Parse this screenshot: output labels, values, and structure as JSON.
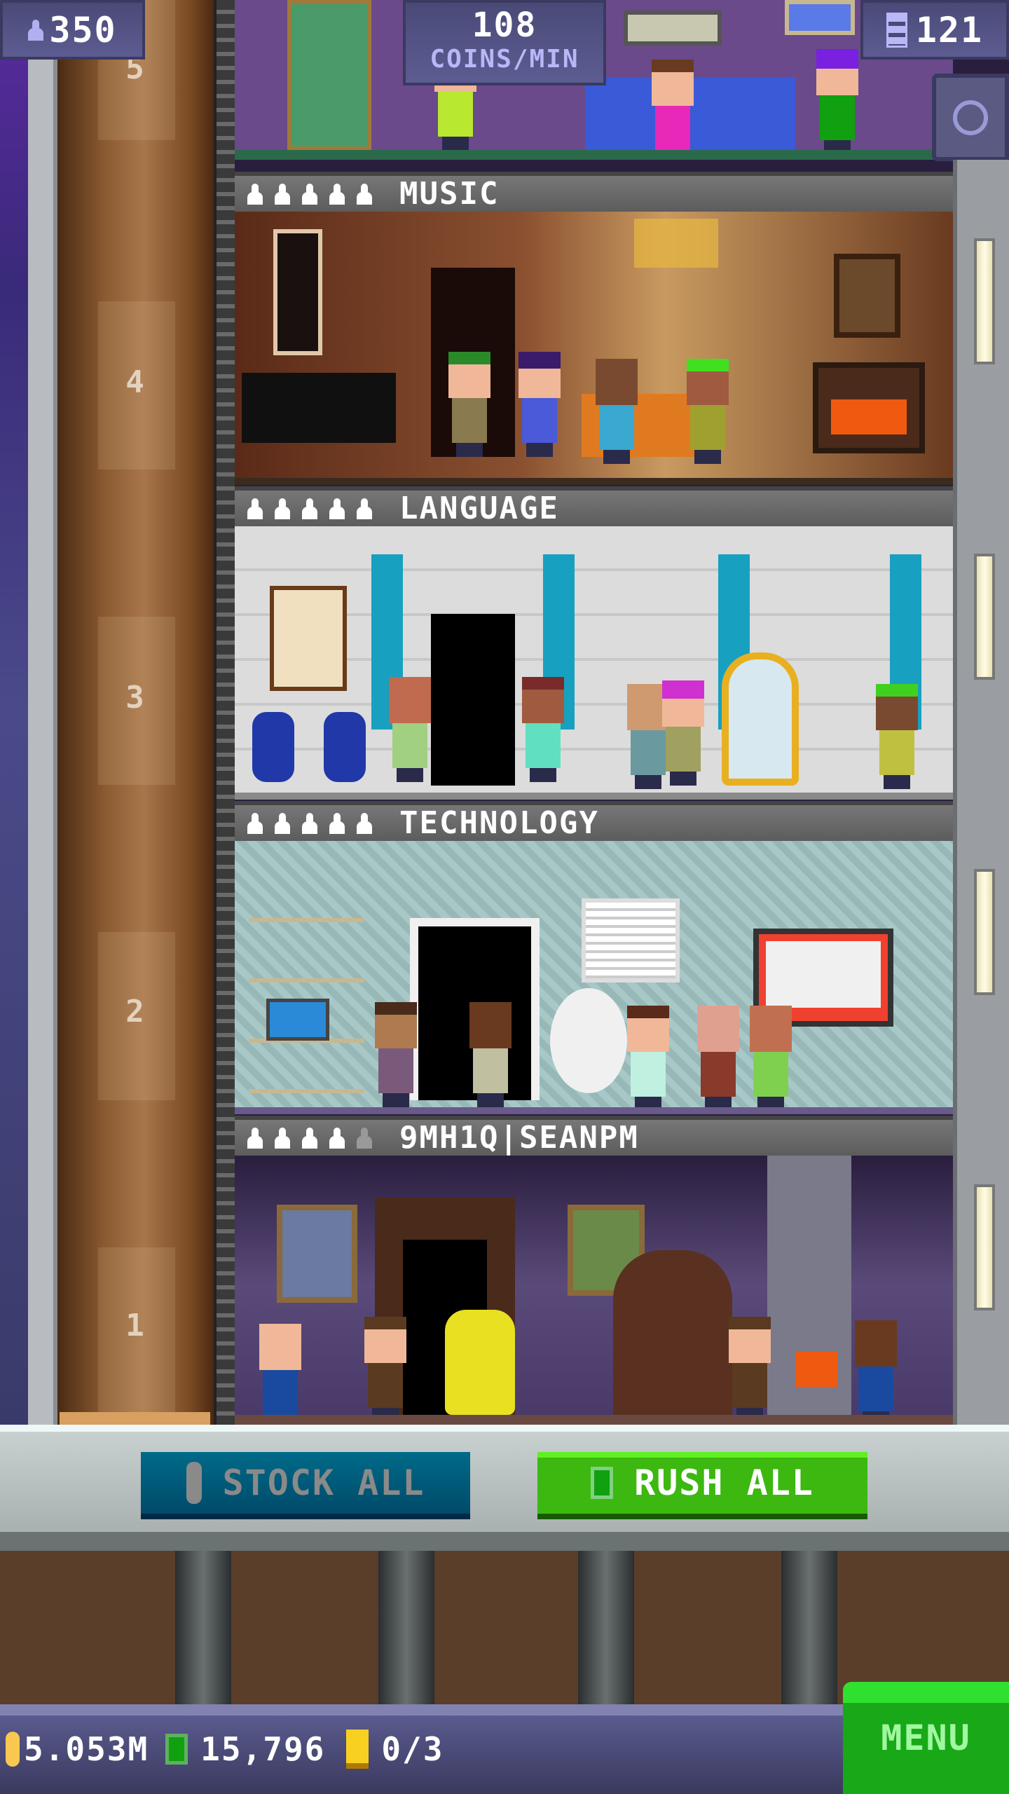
{
  "top_bar": {
    "population": "350",
    "coins_rate_value": "108",
    "coins_rate_unit": "COINS/MIN",
    "floors_count": "121"
  },
  "elevator": {
    "floor_numbers": [
      "5",
      "4",
      "3",
      "2",
      "1"
    ]
  },
  "floors": [
    {
      "name": "MUSIC",
      "residents": 5,
      "capacity": 5,
      "theme_color": "#6b3a22"
    },
    {
      "name": "LANGUAGE",
      "residents": 5,
      "capacity": 5,
      "theme_color": "#d8d8d8"
    },
    {
      "name": "TECHNOLOGY",
      "residents": 5,
      "capacity": 5,
      "theme_color": "#a8c4c4"
    },
    {
      "name": "9MH1Q|SEANPM",
      "residents": 4,
      "capacity": 5,
      "theme_color": "#4a3a6a"
    }
  ],
  "actions": {
    "stock_all": "STOCK ALL",
    "rush_all": "RUSH ALL"
  },
  "bottom_bar": {
    "coins": "5.053M",
    "bux": "15,796",
    "tickets": "0/3",
    "menu": "MENU"
  },
  "colors": {
    "stock": "#00587a",
    "rush": "#38b010",
    "menu": "#1ea81e",
    "bar": "#55558a"
  }
}
